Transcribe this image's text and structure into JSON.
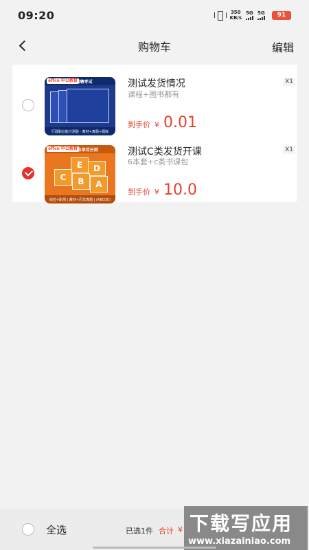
{
  "status_bar": {
    "time": "09:20",
    "net_speed_value": "350",
    "net_speed_unit": "KB/s",
    "signal1_label": "5G",
    "signal2_label": "5G",
    "battery": "91"
  },
  "nav": {
    "title": "购物车",
    "edit_label": "编辑"
  },
  "cart": {
    "items": [
      {
        "title": "测试发货情况",
        "subtitle": "课程+图书都有",
        "quantity": "X1",
        "price_label": "到手价",
        "currency": "¥",
        "price": "0.01",
        "selected": false,
        "thumb_banner": "辅警招聘考试",
        "thumb_logo": "offcn 中公教育",
        "thumb_footer": "行政职业能力测验 · 教材+真题+题库",
        "thumb_color": "#1f3a8a"
      },
      {
        "title": "测试C类发货开课",
        "subtitle": "6本套+c类书课包",
        "quantity": "X1",
        "price_label": "到手价",
        "currency": "¥",
        "price": "10.0",
        "selected": true,
        "thumb_banner": "2025事业单位分类",
        "thumb_logo": "offcn 中公教育",
        "thumb_footer": "综应+职测 | 教材+历年真题 | (ABCDE)",
        "thumb_color": "#e8771f",
        "thumb_letters": [
          "E",
          "D",
          "C",
          "B",
          "A"
        ]
      }
    ]
  },
  "bottom_bar": {
    "select_all_label": "全选",
    "selected_count": "已选1件",
    "total_label": "合计",
    "total_currency": "¥"
  },
  "watermark": {
    "text": "下载写应用",
    "url": "www.xiazainiao.com"
  },
  "colors": {
    "accent": "#e5412d",
    "checked": "#e5312d",
    "background": "#f2f2f2"
  }
}
